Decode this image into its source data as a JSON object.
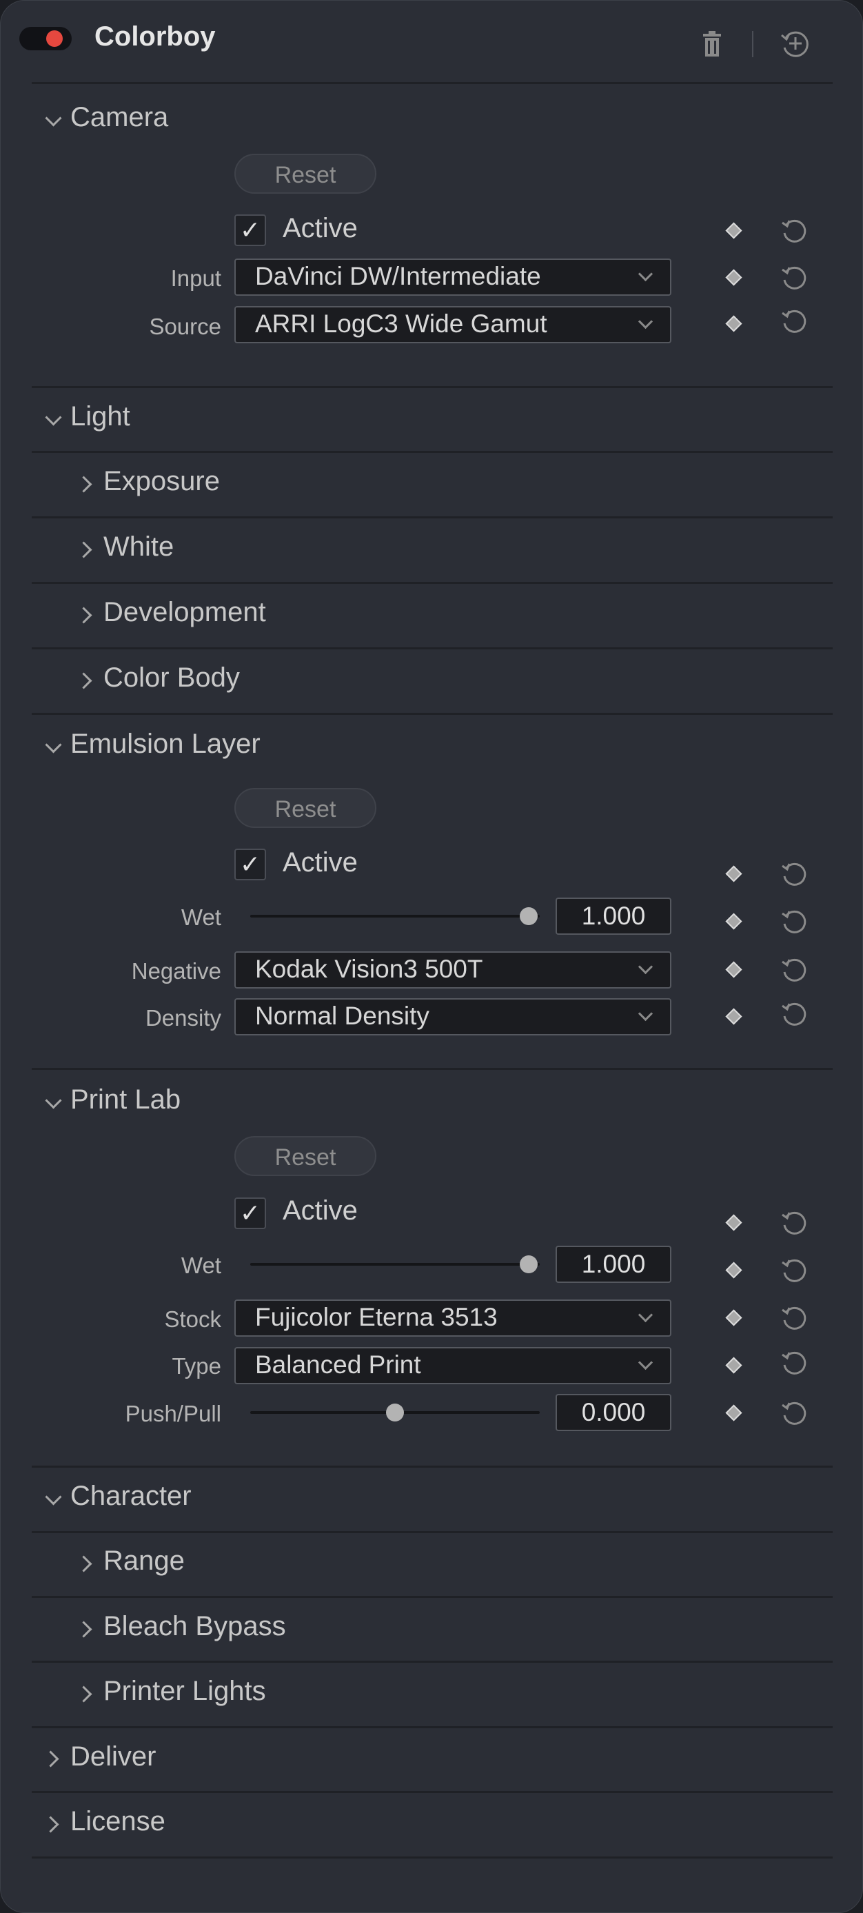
{
  "header": {
    "title": "Colorboy",
    "enabled": true
  },
  "reset_label": "Reset",
  "active_label": "Active",
  "camera": {
    "title": "Camera",
    "active": true,
    "input_label": "Input",
    "input_value": "DaVinci DW/Intermediate",
    "source_label": "Source",
    "source_value": "ARRI LogC3 Wide Gamut"
  },
  "light": {
    "title": "Light",
    "items": [
      "Exposure",
      "White",
      "Development",
      "Color Body"
    ]
  },
  "emulsion": {
    "title": "Emulsion Layer",
    "active": true,
    "wet_label": "Wet",
    "wet_value": "1.000",
    "wet_fraction": 1.0,
    "negative_label": "Negative",
    "negative_value": "Kodak Vision3 500T",
    "density_label": "Density",
    "density_value": "Normal Density"
  },
  "print_lab": {
    "title": "Print Lab",
    "active": true,
    "wet_label": "Wet",
    "wet_value": "1.000",
    "wet_fraction": 1.0,
    "stock_label": "Stock",
    "stock_value": "Fujicolor Eterna 3513",
    "type_label": "Type",
    "type_value": "Balanced Print",
    "pushpull_label": "Push/Pull",
    "pushpull_value": "0.000",
    "pushpull_fraction": 0.5
  },
  "character": {
    "title": "Character",
    "items": [
      "Range",
      "Bleach Bypass",
      "Printer Lights"
    ]
  },
  "deliver": {
    "title": "Deliver"
  },
  "license": {
    "title": "License"
  },
  "colors": {
    "toggle_on": "#e5483f",
    "panel": "#2b2e36",
    "field": "#1b1c20"
  }
}
